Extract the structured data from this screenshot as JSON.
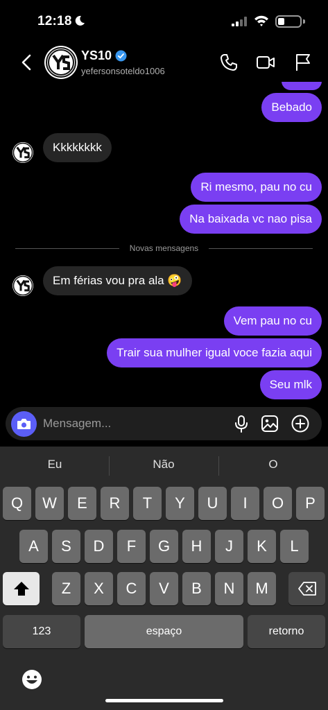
{
  "status_bar": {
    "time": "12:18",
    "battery_level": 0.3
  },
  "header": {
    "name": "YS10",
    "username": "yefersonsoteldo1006",
    "icons": [
      "back-icon",
      "phone-icon",
      "video-icon",
      "flag-icon"
    ],
    "verified_color": "#3897f0"
  },
  "messages": [
    {
      "direction": "out",
      "text": "Bebado"
    },
    {
      "direction": "in",
      "text": "Kkkkkkkk"
    },
    {
      "direction": "out",
      "text": "Ri mesmo, pau no cu"
    },
    {
      "direction": "out",
      "text": "Na baixada vc nao pisa"
    },
    {
      "direction": "in",
      "text": "Em férias vou pra ala 🤪"
    },
    {
      "direction": "out",
      "text": "Vem pau no cu"
    },
    {
      "direction": "out",
      "text": "Trair sua mulher igual voce fazia aqui"
    },
    {
      "direction": "out",
      "text": "Seu mlk"
    }
  ],
  "divider": {
    "label": "Novas mensagens"
  },
  "composer": {
    "placeholder": "Mensagem...",
    "icons": [
      "camera-icon",
      "microphone-icon",
      "gallery-icon",
      "add-icon"
    ]
  },
  "keyboard": {
    "suggestions": [
      "Eu",
      "Não",
      "O"
    ],
    "row1": [
      "Q",
      "W",
      "E",
      "R",
      "T",
      "Y",
      "U",
      "I",
      "O",
      "P"
    ],
    "row2": [
      "A",
      "S",
      "D",
      "F",
      "G",
      "H",
      "J",
      "K",
      "L"
    ],
    "row3": [
      "Z",
      "X",
      "C",
      "V",
      "B",
      "N",
      "M"
    ],
    "numbers_key": "123",
    "space_key": "espaço",
    "return_key": "retorno"
  },
  "colors": {
    "outgoing": "#7a3ff2",
    "incoming": "#262626",
    "camera": "#5b5ef7"
  }
}
